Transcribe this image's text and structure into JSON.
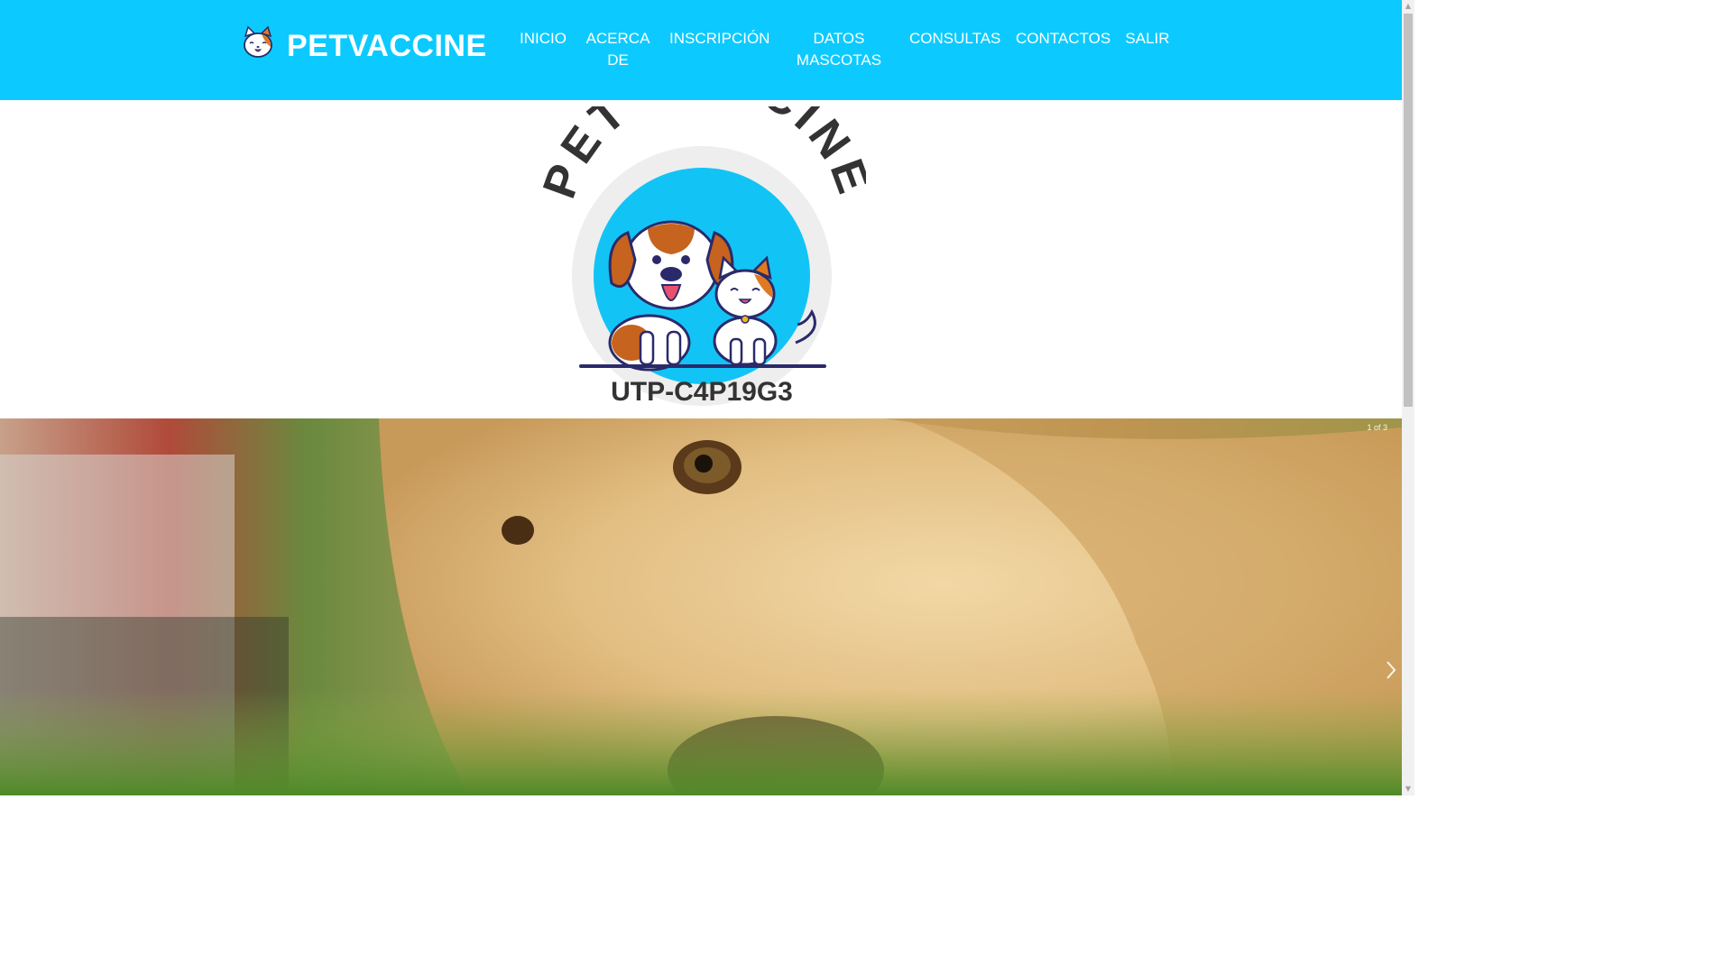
{
  "brand": {
    "name": "PETVACCINE",
    "logo_icon": "cat-face-icon"
  },
  "nav": {
    "inicio": "INICIO",
    "acerca_line1": "ACERCA",
    "acerca_line2": "DE",
    "inscripcion": "INSCRIPCIÓN",
    "datos_line1": "DATOS",
    "datos_line2": "MASCOTAS",
    "consultas": "CONSULTAS",
    "contactos": "CONTACTOS",
    "salir": "SALIR"
  },
  "hero_logo": {
    "arc_text": "PET VACCINE",
    "code": "UTP-C4P19G3"
  },
  "slider": {
    "counter": "1 of 3",
    "image": "golden-dog-sniffing-grass-photo"
  },
  "colors": {
    "navbar": "#0ccaff",
    "nav_text": "#ffffff",
    "logo_circle": "#12c4f5",
    "logo_text": "#333333"
  }
}
